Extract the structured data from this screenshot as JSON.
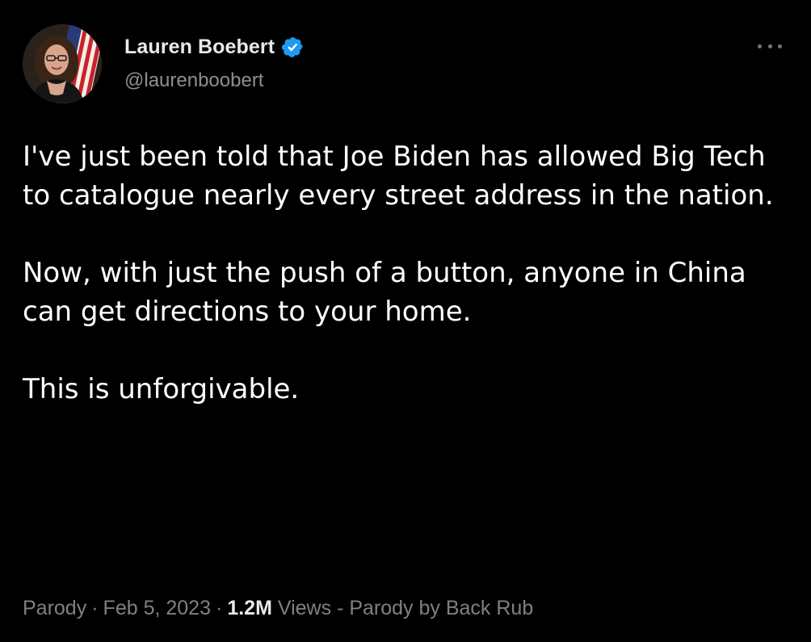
{
  "tweet": {
    "author": {
      "display_name": "Lauren Boebert",
      "handle": "@laurenboobert",
      "verified_icon": "verified-badge-icon",
      "avatar_icon": "profile-photo"
    },
    "more_icon": "more-options-icon",
    "paragraphs": [
      "I've just been told that Joe Biden has allowed Big Tech to catalogue nearly every street address in the nation.",
      "Now, with just the push of a button, anyone in China can get directions to your home.",
      "This is unforgivable."
    ],
    "meta": {
      "label": "Parody",
      "separator": "·",
      "date": "Feb 5, 2023",
      "views_count": "1.2M",
      "views_label": "Views",
      "credit": "- Parody by Back Rub"
    }
  },
  "colors": {
    "background": "#000000",
    "primary_text": "#ffffff",
    "secondary_text": "#7c8187",
    "verified_blue": "#1d9bf0"
  }
}
